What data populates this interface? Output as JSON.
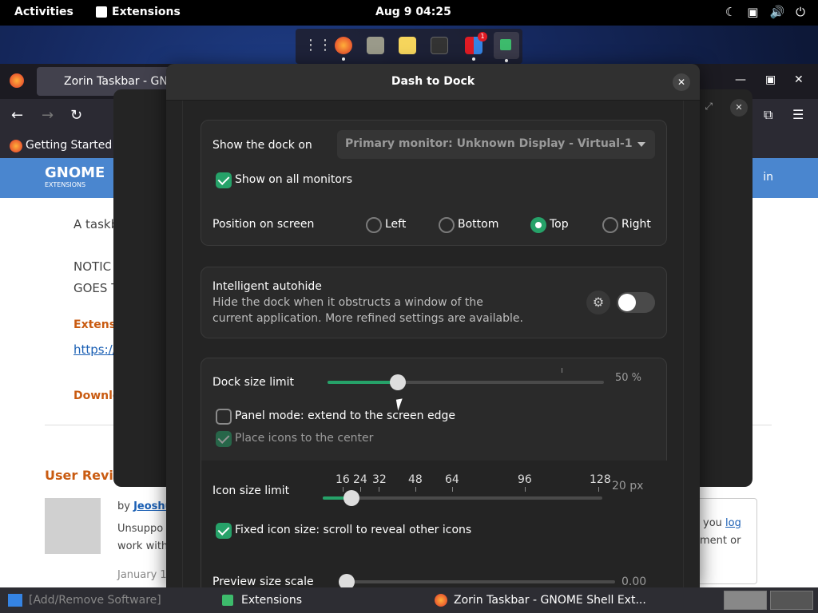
{
  "topbar": {
    "activities": "Activities",
    "app_menu": "Extensions",
    "clock": "Aug 9  04:25"
  },
  "dock": {
    "badge_count": "1",
    "icons": [
      "apps-grid-icon",
      "firefox-icon",
      "files-icon",
      "text-editor-icon",
      "terminal-icon",
      "software-icon",
      "extensions-icon"
    ]
  },
  "browser": {
    "tab_title": "Zorin Taskbar - GNC",
    "bookmark": "Getting Started",
    "logo_text": "GNOME",
    "logo_sub": "EXTENSIONS",
    "login": "in",
    "line1": "A taskb",
    "line2": "NOTIC",
    "line3": "GOES T",
    "ext_label": "Extensio",
    "link": "https://g",
    "download": "Downlo",
    "reviews": "User Review",
    "by": "by",
    "author": "Jeoshu",
    "review1": "Unsuppo",
    "review2": "work with",
    "date": "January 19",
    "right1": "you",
    "right1_link": "log",
    "right2": "ment or"
  },
  "dialog": {
    "title": "Dash to Dock",
    "show_dock_on_label": "Show the dock on",
    "monitor_value": "Primary monitor: Unknown Display - Virtual-1",
    "show_all_monitors": "Show on all monitors",
    "position_label": "Position on screen",
    "positions": [
      "Left",
      "Bottom",
      "Top",
      "Right"
    ],
    "selected_position": "Top",
    "autohide_title": "Intelligent autohide",
    "autohide_desc1": "Hide the dock when it obstructs a window of the",
    "autohide_desc2": "current application. More refined settings are available.",
    "dock_size_label": "Dock size limit",
    "dock_size_value": "50 %",
    "dock_size_fraction": 0.26,
    "panel_mode": "Panel mode: extend to the screen edge",
    "center_icons": "Place icons to the center",
    "icon_size_label": "Icon size limit",
    "icon_marks": [
      "16",
      "24",
      "32",
      "48",
      "64",
      "96",
      "128"
    ],
    "icon_size_value": "20 px",
    "fixed_icon": "Fixed icon size: scroll to reveal other icons",
    "preview_label": "Preview size scale",
    "preview_value": "0.00"
  },
  "taskbar": {
    "items": [
      "[Add/Remove Software]",
      "Extensions",
      "Zorin Taskbar - GNOME Shell Ext..."
    ]
  }
}
